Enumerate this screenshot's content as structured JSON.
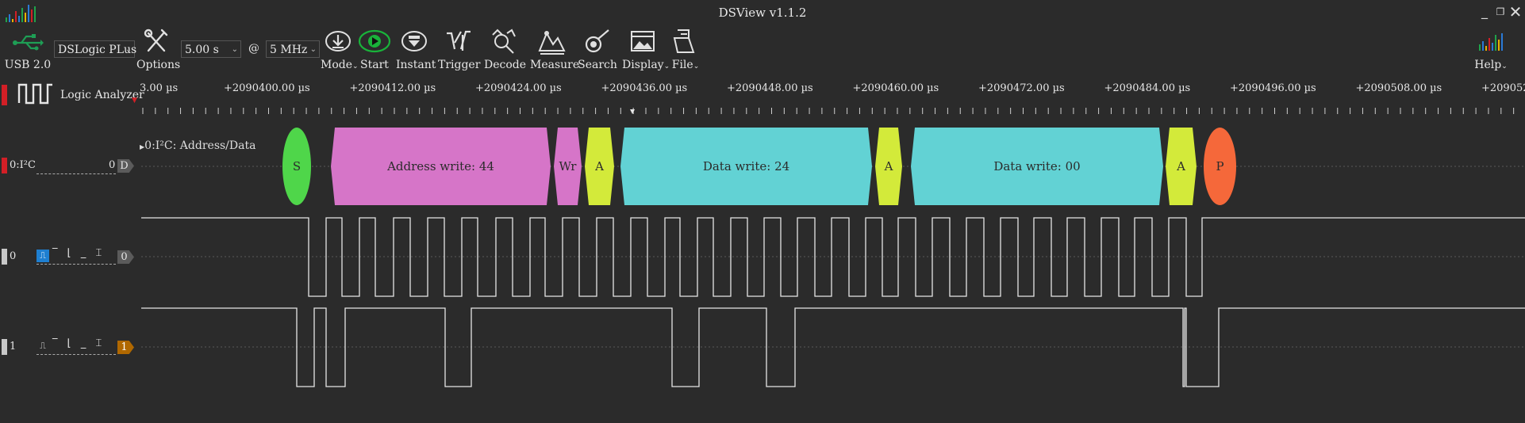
{
  "window": {
    "title": "DSView v1.1.2"
  },
  "toolbar": {
    "usb_label": "USB 2.0",
    "device_select": "DSLogic PLus",
    "options_label": "Options",
    "duration_select": "5.00 s",
    "at_sign": "@",
    "rate_select": "5 MHz",
    "mode_label": "Mode",
    "start_label": "Start",
    "instant_label": "Instant",
    "trigger_label": "Trigger",
    "decode_label": "Decode",
    "measure_label": "Measure",
    "search_label": "Search",
    "display_label": "Display",
    "file_label": "File",
    "help_label": "Help"
  },
  "ruler": {
    "first_label": "3.00 µs",
    "labels": [
      "+2090400.00 µs",
      "+2090412.00 µs",
      "+2090424.00 µs",
      "+2090436.00 µs",
      "+2090448.00 µs",
      "+2090460.00 µs",
      "+2090472.00 µs",
      "+2090484.00 µs",
      "+2090496.00 µs",
      "+2090508.00 µs",
      "+209052"
    ]
  },
  "header": {
    "group_label": "Logic Analyzer"
  },
  "decoder": {
    "channel_name": "0:I²C",
    "channel_value": "0",
    "channel_badge": "D",
    "row_title": "0:I²C: Address/Data",
    "segments": [
      {
        "text": "S",
        "color": "#4fd64a",
        "shape": "ellipse"
      },
      {
        "text": "Address write: 44",
        "color": "#d675c8",
        "shape": "hex"
      },
      {
        "text": "Wr",
        "color": "#d675c8",
        "shape": "hex"
      },
      {
        "text": "A",
        "color": "#d3ea3a",
        "shape": "hex"
      },
      {
        "text": "Data write: 24",
        "color": "#62d2d4",
        "shape": "hex"
      },
      {
        "text": "A",
        "color": "#d3ea3a",
        "shape": "hex"
      },
      {
        "text": "Data write: 00",
        "color": "#62d2d4",
        "shape": "hex"
      },
      {
        "text": "A",
        "color": "#d3ea3a",
        "shape": "hex"
      },
      {
        "text": "P",
        "color": "#f5683a",
        "shape": "ellipse"
      }
    ]
  },
  "channels": [
    {
      "index": "0",
      "badge": "0",
      "badge_color": "#5b5b5b",
      "trigger_active": true
    },
    {
      "index": "1",
      "badge": "1",
      "badge_color": "#b06800",
      "trigger_active": false
    }
  ],
  "colors": {
    "accent_red": "#d21f26",
    "start_green": "#19b33a",
    "trigger_blue": "#1e7fd1"
  }
}
